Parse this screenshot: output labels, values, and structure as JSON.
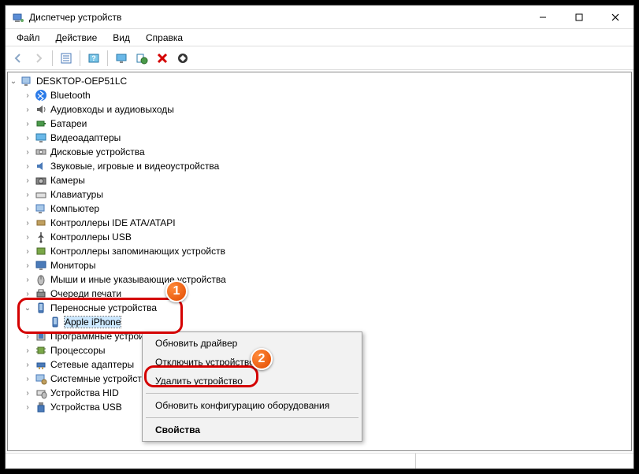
{
  "window": {
    "title": "Диспетчер устройств"
  },
  "menu": {
    "file": "Файл",
    "action": "Действие",
    "view": "Вид",
    "help": "Справка"
  },
  "tree": {
    "root": "DESKTOP-OEP51LC",
    "items": [
      {
        "label": "Bluetooth"
      },
      {
        "label": "Аудиовходы и аудиовыходы"
      },
      {
        "label": "Батареи"
      },
      {
        "label": "Видеоадаптеры"
      },
      {
        "label": "Дисковые устройства"
      },
      {
        "label": "Звуковые, игровые и видеоустройства"
      },
      {
        "label": "Камеры"
      },
      {
        "label": "Клавиатуры"
      },
      {
        "label": "Компьютер"
      },
      {
        "label": "Контроллеры IDE ATA/ATAPI"
      },
      {
        "label": "Контроллеры USB"
      },
      {
        "label": "Контроллеры запоминающих устройств"
      },
      {
        "label": "Мониторы"
      },
      {
        "label": "Мыши и иные указывающие устройства"
      },
      {
        "label": "Очереди печати"
      },
      {
        "label": "Переносные устройства"
      },
      {
        "label": "Apple iPhone"
      },
      {
        "label": "Программные устройства"
      },
      {
        "label": "Процессоры"
      },
      {
        "label": "Сетевые адаптеры"
      },
      {
        "label": "Системные устройства"
      },
      {
        "label": "Устройства HID"
      },
      {
        "label": "Устройства USB"
      }
    ]
  },
  "context_menu": {
    "update_driver": "Обновить драйвер",
    "disable": "Отключить устройство",
    "uninstall": "Удалить устройство",
    "scan": "Обновить конфигурацию оборудования",
    "properties": "Свойства"
  },
  "callouts": {
    "one": "1",
    "two": "2"
  }
}
